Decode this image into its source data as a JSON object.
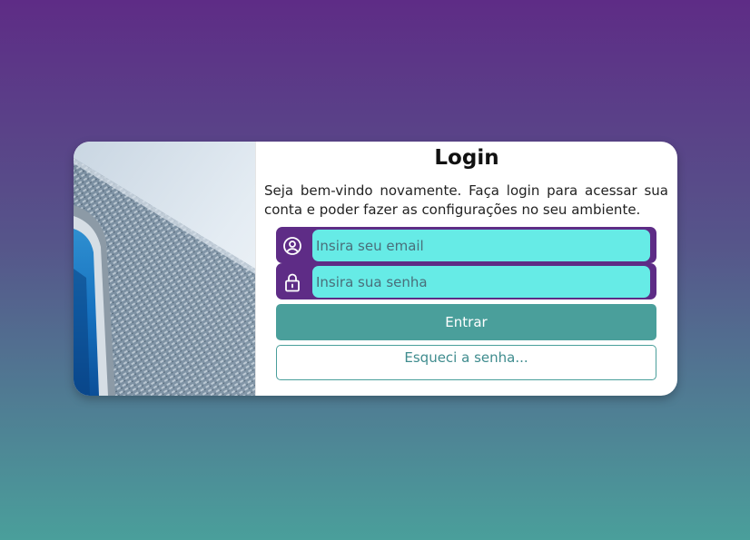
{
  "login": {
    "title": "Login",
    "subtitle": "Seja bem-vindo novamente. Faça login para acessar sua conta e poder fazer as configurações no seu ambiente.",
    "email": {
      "icon": "user-circle-icon",
      "placeholder": "Insira seu email",
      "value": ""
    },
    "password": {
      "icon": "lock-icon",
      "placeholder": "Insira sua senha",
      "value": ""
    },
    "submit_label": "Entrar",
    "forgot_label": "Esqueci a senha..."
  },
  "colors": {
    "brand_purple": "#5e2c86",
    "input_bg": "#66ebe6",
    "accent_teal": "#4a9f9b",
    "background_top": "#5e2c86",
    "background_bottom": "#4a9f9b"
  }
}
